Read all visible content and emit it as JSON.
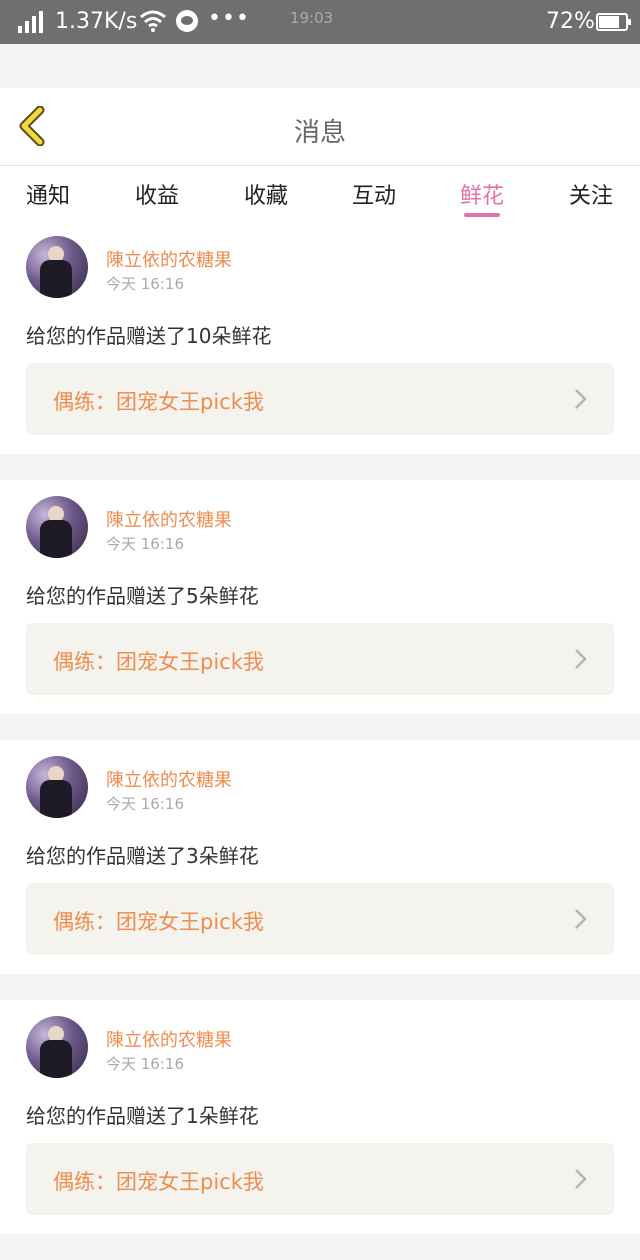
{
  "status_bar": {
    "speed": "1.37K/s",
    "time": "19:03",
    "battery": "72%",
    "dots": "•••"
  },
  "header": {
    "title": "消息",
    "back_icon": "back-chevron-icon"
  },
  "tabs": [
    {
      "label": "通知",
      "active": false
    },
    {
      "label": "收益",
      "active": false
    },
    {
      "label": "收藏",
      "active": false
    },
    {
      "label": "互动",
      "active": false
    },
    {
      "label": "鲜花",
      "active": true
    },
    {
      "label": "关注",
      "active": false
    }
  ],
  "colors": {
    "accent": "#e472a8",
    "orange": "#f08c4e"
  },
  "notifications": [
    {
      "user": "陳立依的农糖果",
      "time": "今天 16:16",
      "message": "给您的作品赠送了10朵鲜花",
      "work": "偶练：团宠女王pick我"
    },
    {
      "user": "陳立依的农糖果",
      "time": "今天 16:16",
      "message": "给您的作品赠送了5朵鲜花",
      "work": "偶练：团宠女王pick我"
    },
    {
      "user": "陳立依的农糖果",
      "time": "今天 16:16",
      "message": "给您的作品赠送了3朵鲜花",
      "work": "偶练：团宠女王pick我"
    },
    {
      "user": "陳立依的农糖果",
      "time": "今天 16:16",
      "message": "给您的作品赠送了1朵鲜花",
      "work": "偶练：团宠女王pick我"
    }
  ]
}
